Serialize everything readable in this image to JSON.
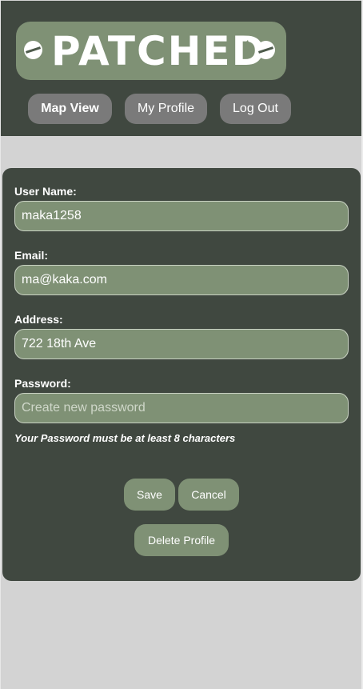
{
  "header": {
    "logo_text": "PATCHED",
    "nav": {
      "map_view": "Map View",
      "my_profile": "My Profile",
      "log_out": "Log Out"
    }
  },
  "form": {
    "username": {
      "label": "User Name:",
      "value": "maka1258"
    },
    "email": {
      "label": "Email:",
      "value": "ma@kaka.com"
    },
    "address": {
      "label": "Address:",
      "value": "722 18th Ave"
    },
    "password": {
      "label": "Password:",
      "value": "",
      "placeholder": "Create new password"
    },
    "password_hint": "Your Password must be at least 8 characters",
    "save_label": "Save",
    "cancel_label": "Cancel",
    "delete_label": "Delete Profile"
  },
  "colors": {
    "header_bg": "#404840",
    "accent_green": "#7f9175",
    "nav_button_gray": "#7a7a7a",
    "page_bg": "#d3d3d3"
  }
}
